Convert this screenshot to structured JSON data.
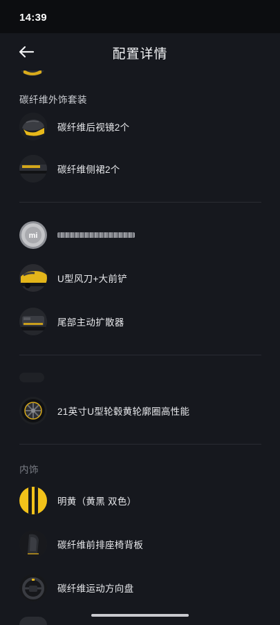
{
  "status_bar": {
    "time": "14:39"
  },
  "header": {
    "title": "配置详情",
    "back_icon": "arrow-left-icon"
  },
  "sections": [
    {
      "title": "碳纤维外饰套装",
      "items": [
        {
          "label": "碳纤维后视镜2个",
          "icon": "mirror-thumbnail"
        },
        {
          "label": "碳纤维侧裙2个",
          "icon": "side-skirt-thumbnail"
        }
      ]
    },
    {
      "title": "",
      "items": [
        {
          "label": "",
          "icon": "mi-badge-thumbnail"
        },
        {
          "label": "U型风刀+大前铲",
          "icon": "front-splitter-thumbnail"
        },
        {
          "label": "尾部主动扩散器",
          "icon": "rear-diffuser-thumbnail"
        }
      ]
    },
    {
      "title": "",
      "items": [
        {
          "label": "21英寸U型轮毂黄轮廓圈高性能",
          "icon": "wheel-thumbnail"
        }
      ]
    },
    {
      "title": "内饰",
      "items": [
        {
          "label": "明黄（黄黑 双色）",
          "icon": "yellow-black-swatch"
        },
        {
          "label": "碳纤维前排座椅背板",
          "icon": "seat-back-thumbnail"
        },
        {
          "label": "碳纤维运动方向盘",
          "icon": "steering-wheel-thumbnail"
        }
      ]
    }
  ],
  "colors": {
    "background": "#16181e",
    "accent_yellow": "#f2c21a",
    "divider": "#2a2c33"
  }
}
